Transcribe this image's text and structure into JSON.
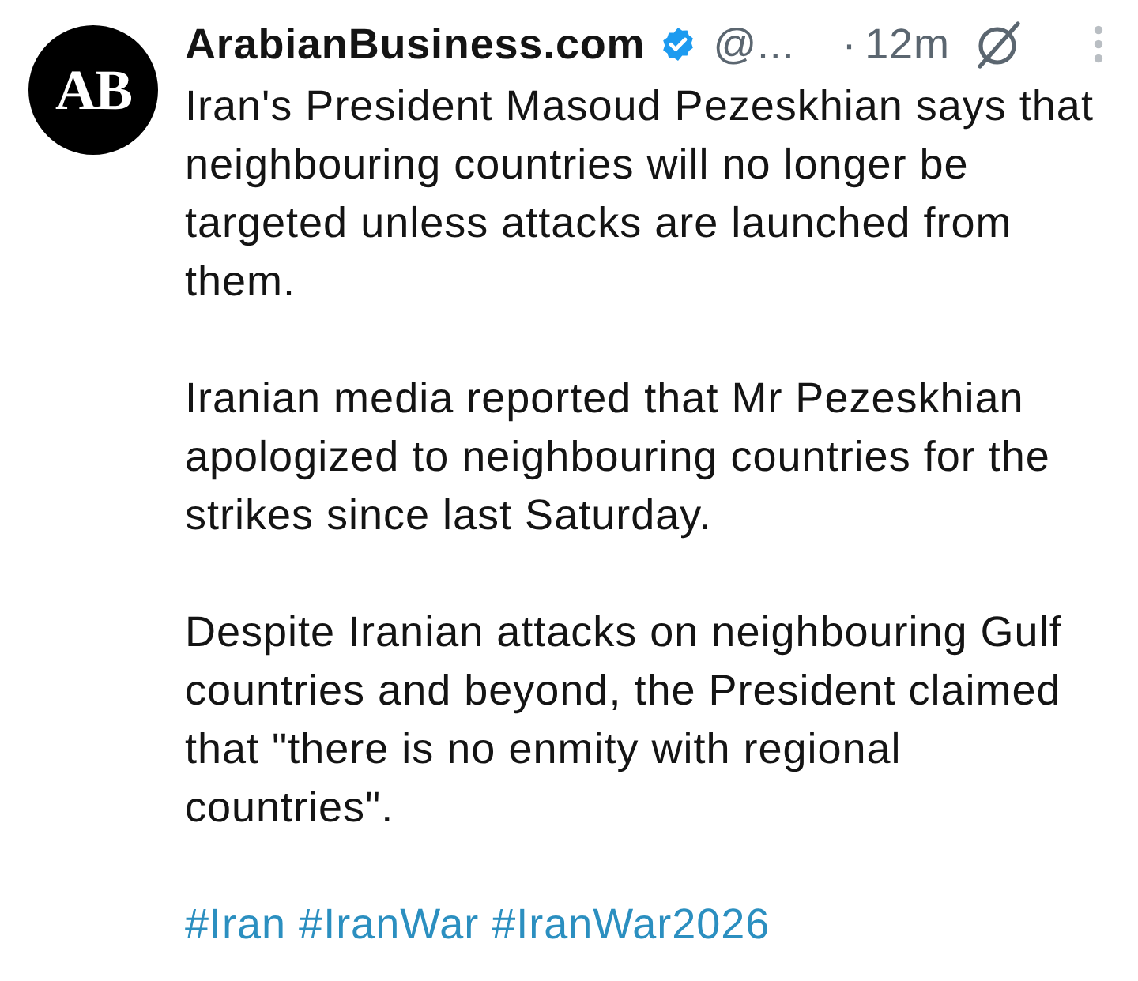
{
  "avatar": {
    "text": "AB"
  },
  "author": {
    "name": "ArabianBusiness.com",
    "verified": true,
    "handle": "@...",
    "separator": "·",
    "time": "12m"
  },
  "body": {
    "paragraphs": [
      "Iran's President Masoud Pezeskhian says that neighbouring countries will no longer be targeted unless attacks are launched from them.",
      "Iranian media reported that Mr Pezeskhian apologized to neighbouring countries for the strikes since last Saturday.",
      "Despite Iranian attacks on neighbouring Gulf countries and beyond, the President claimed that \"there is no enmity with regional countries\"."
    ],
    "hashtags": [
      "#Iran",
      "#IranWar",
      "#IranWar2026"
    ]
  }
}
